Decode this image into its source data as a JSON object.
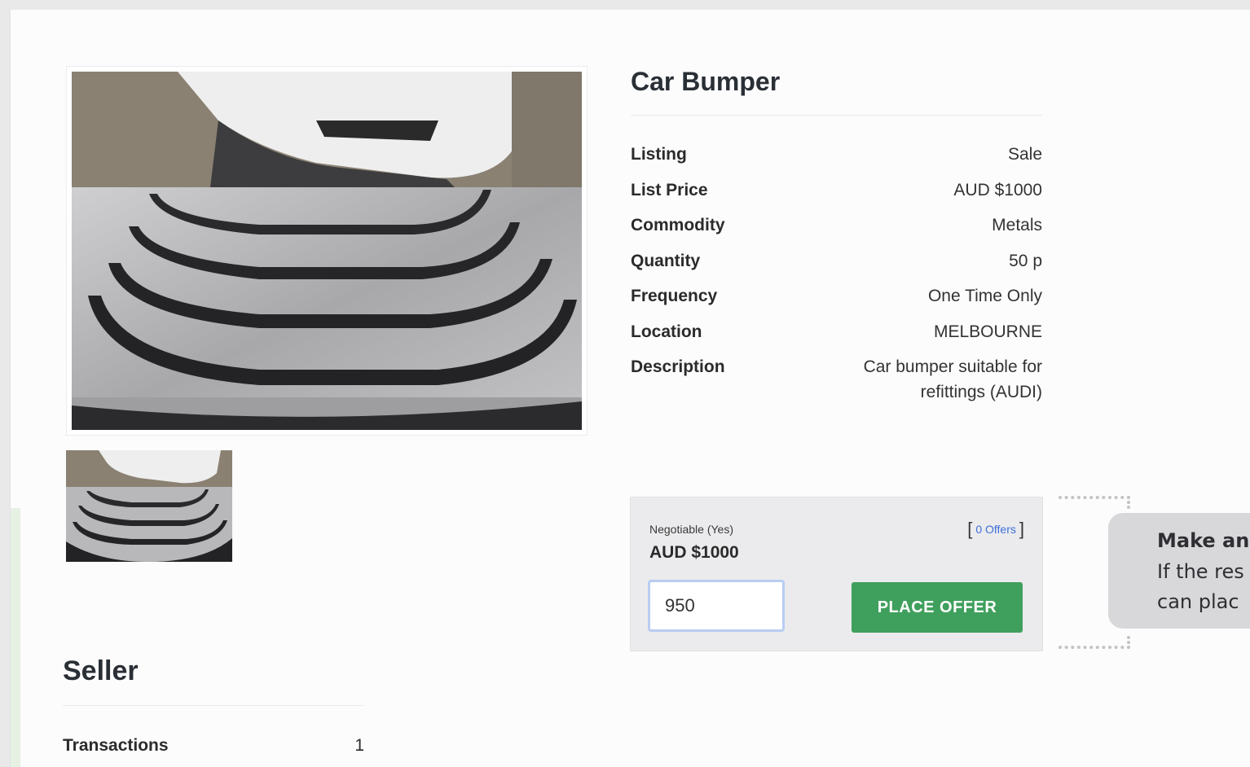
{
  "listing": {
    "title": "Car Bumper",
    "specs": [
      {
        "label": "Listing",
        "value": "Sale"
      },
      {
        "label": "List Price",
        "value": "AUD $1000"
      },
      {
        "label": "Commodity",
        "value": "Metals"
      },
      {
        "label": "Quantity",
        "value": "50 p"
      },
      {
        "label": "Frequency",
        "value": "One Time Only"
      },
      {
        "label": "Location",
        "value": "MELBOURNE"
      },
      {
        "label": "Description",
        "value": "Car bumper suitable for refittings (AUDI)"
      }
    ]
  },
  "offer": {
    "negotiable_label": "Negotiable (Yes)",
    "offers_bracket_open": "[",
    "offers_count": "0 Offers",
    "offers_bracket_close": "]",
    "price": "AUD $1000",
    "input_value": "950",
    "button_label": "PLACE OFFER",
    "button_color": "#3f9f5c"
  },
  "tooltip": {
    "title": "Make an",
    "line1": "If the res",
    "line2": "can plac"
  },
  "seller": {
    "title": "Seller",
    "rows": [
      {
        "label": "Transactions",
        "value": "1"
      }
    ]
  },
  "images": {
    "main_photo": "car-bumper-photo",
    "thumbnail": "car-bumper-thumbnail"
  }
}
